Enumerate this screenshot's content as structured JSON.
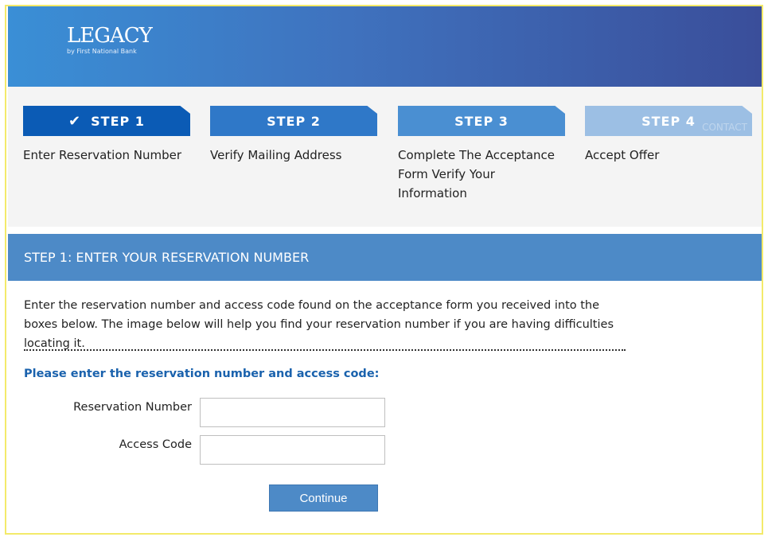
{
  "brand": {
    "name": "LEGACY",
    "tagline": "by First National Bank"
  },
  "steps": [
    {
      "label": "STEP 1",
      "description": "Enter Reservation Number",
      "completed": true,
      "icon": "check-icon"
    },
    {
      "label": "STEP 2",
      "description": "Verify Mailing Address",
      "completed": false
    },
    {
      "label": "STEP 3",
      "description": "Complete The Acceptance Form Verify Your Information",
      "completed": false
    },
    {
      "label": "STEP 4",
      "description": "Accept Offer",
      "completed": false,
      "ghost_text": "CONTACT"
    }
  ],
  "section": {
    "title": "STEP 1: ENTER YOUR RESERVATION NUMBER",
    "intro": "Enter the reservation number and access code found on the acceptance form you received into the boxes below. The image below will help you find your reservation number if you are having difficulties locating it.",
    "prompt": "Please enter the reservation number and access code:"
  },
  "form": {
    "reservation_label": "Reservation Number",
    "reservation_value": "",
    "access_label": "Access Code",
    "access_value": "",
    "continue_label": "Continue"
  },
  "colors": {
    "step1": "#0b5bb5",
    "step2": "#2f78c8",
    "step3": "#4a8fd2",
    "step4": "#9cbfe4",
    "section_bar": "#4d8ac7",
    "prompt_text": "#1a62ad",
    "frame_border": "#f3ea6a"
  }
}
